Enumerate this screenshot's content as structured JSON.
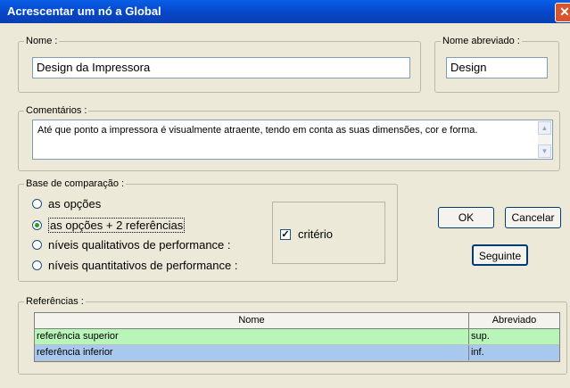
{
  "window": {
    "title": "Acrescentar um nó a Global",
    "close_glyph": "✕"
  },
  "nome": {
    "label": "Nome :",
    "value": "Design da Impressora"
  },
  "nome_abreviado": {
    "label": "Nome abreviado :",
    "value": "Design"
  },
  "comentarios": {
    "label": "Comentários :",
    "value": "Até que ponto a impressora é visualmente atraente, tendo em conta as suas dimensões, cor e forma."
  },
  "base_comparacao": {
    "label": "Base de comparação :",
    "options": [
      {
        "label": "as opções",
        "checked": false
      },
      {
        "label": "as opções + 2 referências",
        "checked": true
      },
      {
        "label": "níveis qualitativos de performance :",
        "checked": false
      },
      {
        "label": "níveis quantitativos de performance :",
        "checked": false
      }
    ],
    "checkbox": {
      "label": "critério",
      "checked": true
    }
  },
  "buttons": {
    "ok": "OK",
    "cancelar": "Cancelar",
    "seguinte": "Seguinte"
  },
  "referencias": {
    "label": "Referências :",
    "columns": [
      "Nome",
      "Abreviado"
    ],
    "rows": [
      {
        "nome": "referência superior",
        "abreviado": "sup.",
        "color": "#b8f5b8"
      },
      {
        "nome": "referência inferior",
        "abreviado": "inf.",
        "color": "#a9c8ee"
      }
    ]
  }
}
